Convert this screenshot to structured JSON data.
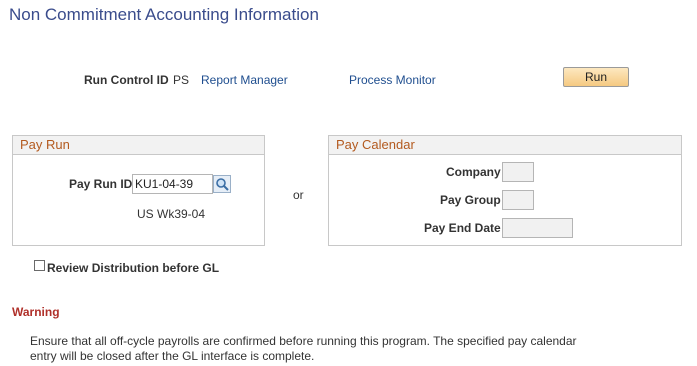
{
  "page": {
    "title": "Non Commitment Accounting Information"
  },
  "run_control": {
    "label": "Run Control ID",
    "value": "PS",
    "report_manager": "Report Manager",
    "process_monitor": "Process Monitor",
    "run_button": "Run"
  },
  "pay_run": {
    "header": "Pay Run",
    "id_label": "Pay Run ID",
    "id_value": "KU1-04-39",
    "description": "US Wk39-04"
  },
  "or_label": "or",
  "pay_calendar": {
    "header": "Pay Calendar",
    "company_label": "Company",
    "company_value": "",
    "pay_group_label": "Pay Group",
    "pay_group_value": "",
    "pay_end_date_label": "Pay End Date",
    "pay_end_date_value": ""
  },
  "review_distribution": {
    "label": "Review Distribution before GL",
    "checked": false
  },
  "warning": {
    "title": "Warning",
    "line1": "Ensure that all off-cycle payrolls are confirmed before running this program. The specified pay calendar",
    "line2": "entry will be closed after the GL interface is complete."
  },
  "colors": {
    "title": "#3a4c8c",
    "link": "#1f4e8f",
    "group_header": "#b35a1f",
    "warning": "#b0302a",
    "run_button": "#f5c981"
  },
  "icons": {
    "lookup": "magnifier-icon"
  }
}
